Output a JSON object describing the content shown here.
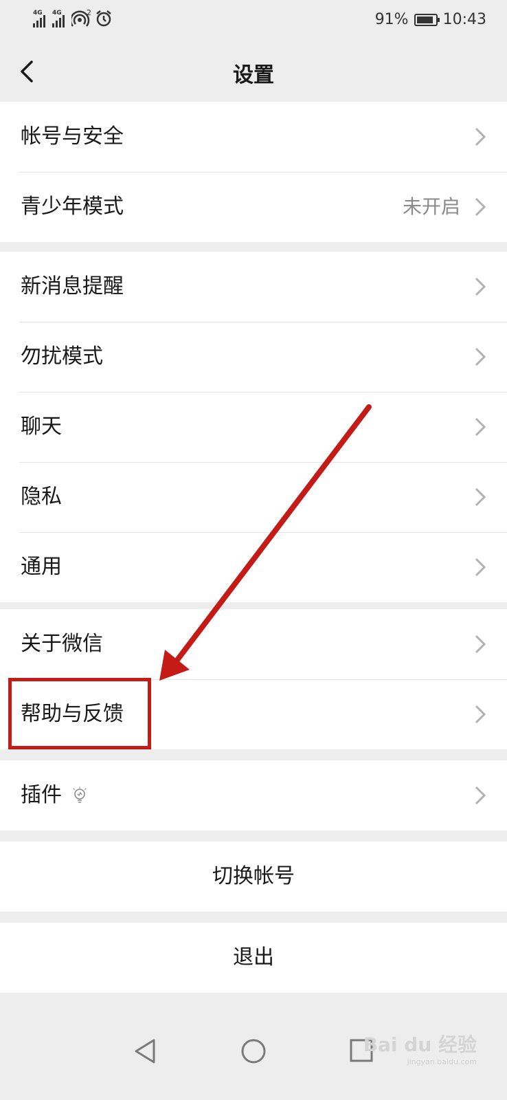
{
  "status": {
    "network_labels": [
      "4G",
      "4G"
    ],
    "hotspot_count": "2",
    "battery": "91%",
    "battery_level": 0.91,
    "time": "10:43"
  },
  "header": {
    "title": "设置"
  },
  "groups": [
    {
      "items": [
        {
          "label": "帐号与安全"
        },
        {
          "label": "青少年模式",
          "value": "未开启"
        }
      ]
    },
    {
      "items": [
        {
          "label": "新消息提醒"
        },
        {
          "label": "勿扰模式"
        },
        {
          "label": "聊天"
        },
        {
          "label": "隐私"
        },
        {
          "label": "通用"
        }
      ]
    },
    {
      "items": [
        {
          "label": "关于微信"
        },
        {
          "label": "帮助与反馈"
        }
      ]
    },
    {
      "items": [
        {
          "label": "插件",
          "icon": "bulb-icon"
        }
      ]
    }
  ],
  "actions": {
    "switch_account": "切换帐号",
    "logout": "退出"
  },
  "annotation": {
    "color": "#c41b17",
    "highlighted_item": "帮助与反馈"
  },
  "watermark": {
    "brand": "Bai du 经验",
    "url": "jingyan.baidu.com"
  },
  "colors": {
    "background": "#ededed",
    "card": "#ffffff",
    "text": "#191919",
    "secondary": "#8a8a8a"
  }
}
